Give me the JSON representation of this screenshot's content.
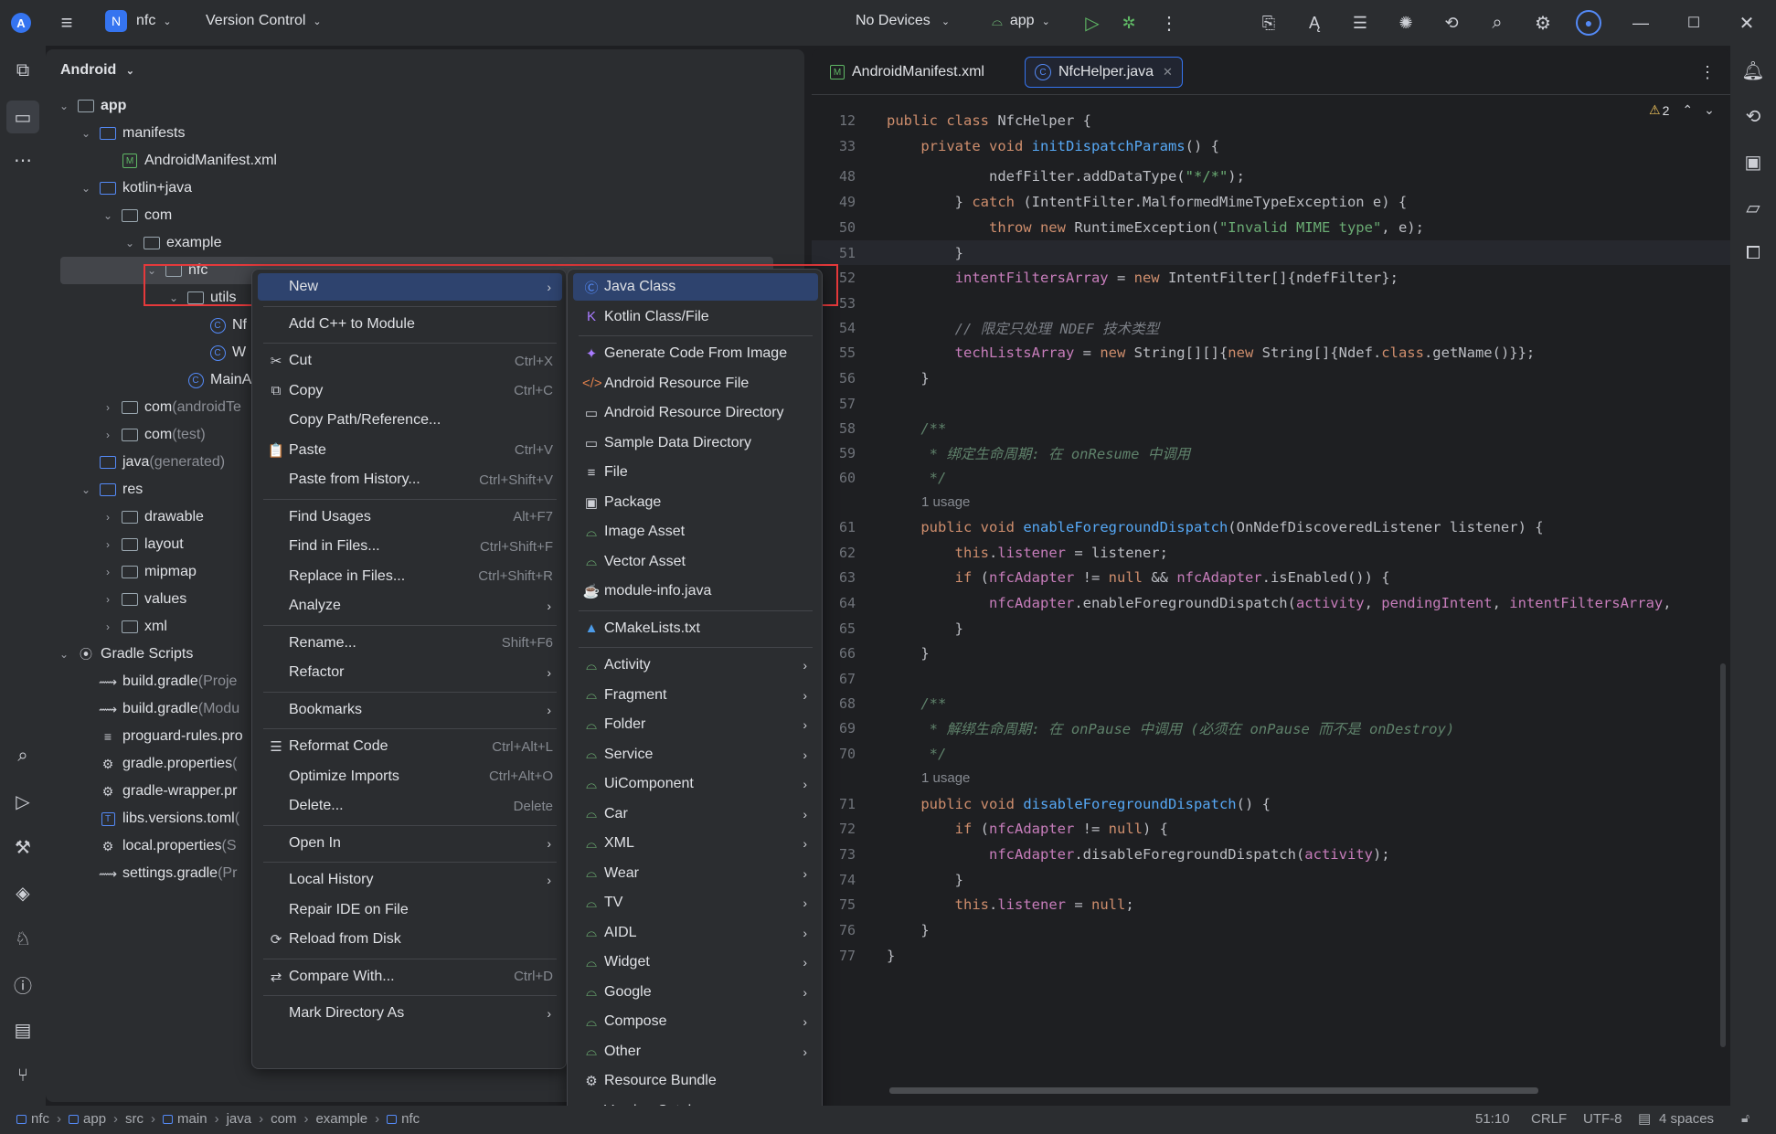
{
  "titlebar": {
    "project_badge": "N",
    "project_name": "nfc",
    "vcs": "Version Control",
    "device": "No Devices",
    "run_config": "app"
  },
  "project_panel": {
    "title": "Android",
    "rows": [
      {
        "label": "app",
        "extra": "",
        "indent": 0,
        "chev": "v",
        "icon": "module-folder-icon",
        "bold": true
      },
      {
        "label": "manifests",
        "extra": "",
        "indent": 1,
        "chev": "v",
        "icon": "folder-icon"
      },
      {
        "label": "AndroidManifest.xml",
        "extra": "",
        "indent": 2,
        "chev": "",
        "icon": "manifest-icon"
      },
      {
        "label": "kotlin+java",
        "extra": "",
        "indent": 1,
        "chev": "v",
        "icon": "folder-icon"
      },
      {
        "label": "com",
        "extra": "",
        "indent": 2,
        "chev": "v",
        "icon": "package-icon"
      },
      {
        "label": "example",
        "extra": "",
        "indent": 3,
        "chev": "v",
        "icon": "package-icon"
      },
      {
        "label": "nfc",
        "extra": "",
        "indent": 4,
        "chev": "v",
        "icon": "package-icon"
      },
      {
        "label": "utils",
        "extra": "",
        "indent": 5,
        "chev": "v",
        "icon": "package-icon"
      },
      {
        "label": "Nf",
        "extra": "",
        "indent": 6,
        "chev": "",
        "icon": "class-icon"
      },
      {
        "label": "W",
        "extra": "",
        "indent": 6,
        "chev": "",
        "icon": "class-icon"
      },
      {
        "label": "MainA",
        "extra": "",
        "indent": 5,
        "chev": "",
        "icon": "class-icon"
      },
      {
        "label": "com",
        "extra": " (androidTe",
        "indent": 2,
        "chev": ">",
        "icon": "package-icon"
      },
      {
        "label": "com",
        "extra": " (test)",
        "indent": 2,
        "chev": ">",
        "icon": "package-icon"
      },
      {
        "label": "java",
        "extra": " (generated)",
        "indent": 1,
        "chev": "",
        "icon": "folder-icon"
      },
      {
        "label": "res",
        "extra": "",
        "indent": 1,
        "chev": "v",
        "icon": "res-folder-icon"
      },
      {
        "label": "drawable",
        "extra": "",
        "indent": 2,
        "chev": ">",
        "icon": "package-icon"
      },
      {
        "label": "layout",
        "extra": "",
        "indent": 2,
        "chev": ">",
        "icon": "package-icon"
      },
      {
        "label": "mipmap",
        "extra": "",
        "indent": 2,
        "chev": ">",
        "icon": "package-icon"
      },
      {
        "label": "values",
        "extra": "",
        "indent": 2,
        "chev": ">",
        "icon": "package-icon"
      },
      {
        "label": "xml",
        "extra": "",
        "indent": 2,
        "chev": ">",
        "icon": "package-icon"
      },
      {
        "label": "Gradle Scripts",
        "extra": "",
        "indent": 0,
        "chev": "v",
        "icon": "gradle-icon"
      },
      {
        "label": "build.gradle",
        "extra": " (Proje",
        "indent": 1,
        "chev": "",
        "icon": "gradle-file-icon"
      },
      {
        "label": "build.gradle",
        "extra": " (Modu",
        "indent": 1,
        "chev": "",
        "icon": "gradle-file-icon"
      },
      {
        "label": "proguard-rules.pro",
        "extra": "",
        "indent": 1,
        "chev": "",
        "icon": "text-file-icon"
      },
      {
        "label": "gradle.properties",
        "extra": " (",
        "indent": 1,
        "chev": "",
        "icon": "settings-file-icon"
      },
      {
        "label": "gradle-wrapper.pr",
        "extra": "",
        "indent": 1,
        "chev": "",
        "icon": "settings-file-icon"
      },
      {
        "label": "libs.versions.toml",
        "extra": " (",
        "indent": 1,
        "chev": "",
        "icon": "toml-file-icon"
      },
      {
        "label": "local.properties",
        "extra": " (S",
        "indent": 1,
        "chev": "",
        "icon": "settings-file-icon"
      },
      {
        "label": "settings.gradle",
        "extra": " (Pr",
        "indent": 1,
        "chev": "",
        "icon": "gradle-file-icon"
      }
    ]
  },
  "editor": {
    "tabs": [
      {
        "label": "AndroidManifest.xml",
        "icon": "manifest-icon"
      },
      {
        "label": "NfcHelper.java",
        "icon": "class-icon"
      }
    ],
    "warnings": "2",
    "usage_text": "1 usage"
  },
  "context_menu": {
    "items": [
      {
        "label": "New",
        "key": "",
        "arrow": true,
        "icon": "",
        "sel": true
      },
      {
        "sep": true
      },
      {
        "label": "Add C++ to Module",
        "key": "",
        "icon": ""
      },
      {
        "sep": true
      },
      {
        "label": "Cut",
        "key": "Ctrl+X",
        "icon": "✂"
      },
      {
        "label": "Copy",
        "key": "Ctrl+C",
        "icon": "⧉"
      },
      {
        "label": "Copy Path/Reference...",
        "key": "",
        "icon": ""
      },
      {
        "label": "Paste",
        "key": "Ctrl+V",
        "icon": "📋"
      },
      {
        "label": "Paste from History...",
        "key": "Ctrl+Shift+V",
        "icon": ""
      },
      {
        "sep": true
      },
      {
        "label": "Find Usages",
        "key": "Alt+F7",
        "icon": ""
      },
      {
        "label": "Find in Files...",
        "key": "Ctrl+Shift+F",
        "icon": ""
      },
      {
        "label": "Replace in Files...",
        "key": "Ctrl+Shift+R",
        "icon": ""
      },
      {
        "label": "Analyze",
        "key": "",
        "arrow": true,
        "icon": ""
      },
      {
        "sep": true
      },
      {
        "label": "Rename...",
        "key": "Shift+F6",
        "icon": ""
      },
      {
        "label": "Refactor",
        "key": "",
        "arrow": true,
        "icon": ""
      },
      {
        "sep": true
      },
      {
        "label": "Bookmarks",
        "key": "",
        "arrow": true,
        "icon": ""
      },
      {
        "sep": true
      },
      {
        "label": "Reformat Code",
        "key": "Ctrl+Alt+L",
        "icon": "☰"
      },
      {
        "label": "Optimize Imports",
        "key": "Ctrl+Alt+O",
        "icon": ""
      },
      {
        "label": "Delete...",
        "key": "Delete",
        "icon": ""
      },
      {
        "sep": true
      },
      {
        "label": "Open In",
        "key": "",
        "arrow": true,
        "icon": ""
      },
      {
        "sep": true
      },
      {
        "label": "Local History",
        "key": "",
        "arrow": true,
        "icon": ""
      },
      {
        "label": "Repair IDE on File",
        "key": "",
        "icon": ""
      },
      {
        "label": "Reload from Disk",
        "key": "",
        "icon": "⟳"
      },
      {
        "sep": true
      },
      {
        "label": "Compare With...",
        "key": "Ctrl+D",
        "icon": "⇄"
      },
      {
        "sep": true
      },
      {
        "label": "Mark Directory As",
        "key": "",
        "arrow": true,
        "icon": ""
      }
    ]
  },
  "submenu": {
    "items": [
      {
        "label": "Java Class",
        "icon": "Ⓒ",
        "iconColor": "#548af7",
        "sel": true
      },
      {
        "label": "Kotlin Class/File",
        "icon": "K",
        "iconColor": "#a97bff"
      },
      {
        "sep": true
      },
      {
        "label": "Generate Code From Image",
        "icon": "✦",
        "iconColor": "#a97bff"
      },
      {
        "label": "Android Resource File",
        "icon": "</>",
        "iconColor": "#e0804c"
      },
      {
        "label": "Android Resource Directory",
        "icon": "▭",
        "iconColor": "#ced0d6"
      },
      {
        "label": "Sample Data Directory",
        "icon": "▭",
        "iconColor": "#ced0d6"
      },
      {
        "label": "File",
        "icon": "≡",
        "iconColor": "#ced0d6"
      },
      {
        "label": "Package",
        "icon": "▣",
        "iconColor": "#ced0d6"
      },
      {
        "label": "Image Asset",
        "icon": "⌓",
        "iconColor": "#73bd79"
      },
      {
        "label": "Vector Asset",
        "icon": "⌓",
        "iconColor": "#73bd79"
      },
      {
        "label": "module-info.java",
        "icon": "☕",
        "iconColor": "#e0804c"
      },
      {
        "sep": true
      },
      {
        "label": "CMakeLists.txt",
        "icon": "▲",
        "iconColor": "#4c9be8"
      },
      {
        "sep": true
      },
      {
        "label": "Activity",
        "icon": "⌓",
        "iconColor": "#73bd79",
        "arrow": true
      },
      {
        "label": "Fragment",
        "icon": "⌓",
        "iconColor": "#73bd79",
        "arrow": true
      },
      {
        "label": "Folder",
        "icon": "⌓",
        "iconColor": "#73bd79",
        "arrow": true
      },
      {
        "label": "Service",
        "icon": "⌓",
        "iconColor": "#73bd79",
        "arrow": true
      },
      {
        "label": "UiComponent",
        "icon": "⌓",
        "iconColor": "#73bd79",
        "arrow": true
      },
      {
        "label": "Car",
        "icon": "⌓",
        "iconColor": "#73bd79",
        "arrow": true
      },
      {
        "label": "XML",
        "icon": "⌓",
        "iconColor": "#73bd79",
        "arrow": true
      },
      {
        "label": "Wear",
        "icon": "⌓",
        "iconColor": "#73bd79",
        "arrow": true
      },
      {
        "label": "TV",
        "icon": "⌓",
        "iconColor": "#73bd79",
        "arrow": true
      },
      {
        "label": "AIDL",
        "icon": "⌓",
        "iconColor": "#73bd79",
        "arrow": true
      },
      {
        "label": "Widget",
        "icon": "⌓",
        "iconColor": "#73bd79",
        "arrow": true
      },
      {
        "label": "Google",
        "icon": "⌓",
        "iconColor": "#73bd79",
        "arrow": true
      },
      {
        "label": "Compose",
        "icon": "⌓",
        "iconColor": "#73bd79",
        "arrow": true
      },
      {
        "label": "Other",
        "icon": "⌓",
        "iconColor": "#73bd79",
        "arrow": true
      },
      {
        "label": "Resource Bundle",
        "icon": "⚙",
        "iconColor": "#ced0d6"
      },
      {
        "label": "Version Catalog",
        "icon": "⚙",
        "iconColor": "#ced0d6"
      }
    ]
  },
  "statusbar": {
    "breadcrumb": [
      "nfc",
      "app",
      "src",
      "main",
      "java",
      "com",
      "example",
      "nfc"
    ],
    "position": "51:10",
    "line_sep": "CRLF",
    "encoding": "UTF-8",
    "indent": "4 spaces"
  },
  "colors": {
    "accent": "#3574f0",
    "highlight_border": "#e5393b",
    "selection": "#2e436e"
  }
}
